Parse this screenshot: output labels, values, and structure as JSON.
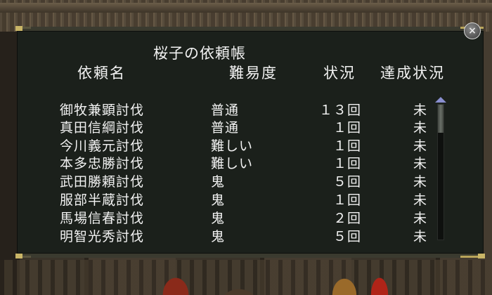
{
  "dialog": {
    "title": "桜子の依頼帳",
    "close_label": "×"
  },
  "headers": {
    "name": "依頼名",
    "difficulty": "難易度",
    "count": "状況",
    "status": "達成状況"
  },
  "rows": [
    {
      "name": "御牧兼顕討伐",
      "difficulty": "普通",
      "count": "１３回",
      "status": "未"
    },
    {
      "name": "真田信綱討伐",
      "difficulty": "普通",
      "count": "１回",
      "status": "未"
    },
    {
      "name": "今川義元討伐",
      "difficulty": "難しい",
      "count": "１回",
      "status": "未"
    },
    {
      "name": "本多忠勝討伐",
      "difficulty": "難しい",
      "count": "１回",
      "status": "未"
    },
    {
      "name": "武田勝頼討伐",
      "difficulty": "鬼",
      "count": "５回",
      "status": "未"
    },
    {
      "name": "服部半蔵討伐",
      "difficulty": "鬼",
      "count": "１回",
      "status": "未"
    },
    {
      "name": "馬場信春討伐",
      "difficulty": "鬼",
      "count": "２回",
      "status": "未"
    },
    {
      "name": "明智光秀討伐",
      "difficulty": "鬼",
      "count": "５回",
      "status": "未"
    }
  ],
  "colors": {
    "panel_bg": "#1b201b",
    "text": "#f2f2f2",
    "accent_gold": "#c9b567",
    "scroll_arrow": "#8a8fd0"
  },
  "icons": {
    "close": "close-icon",
    "scroll_up": "triangle-up-icon"
  }
}
